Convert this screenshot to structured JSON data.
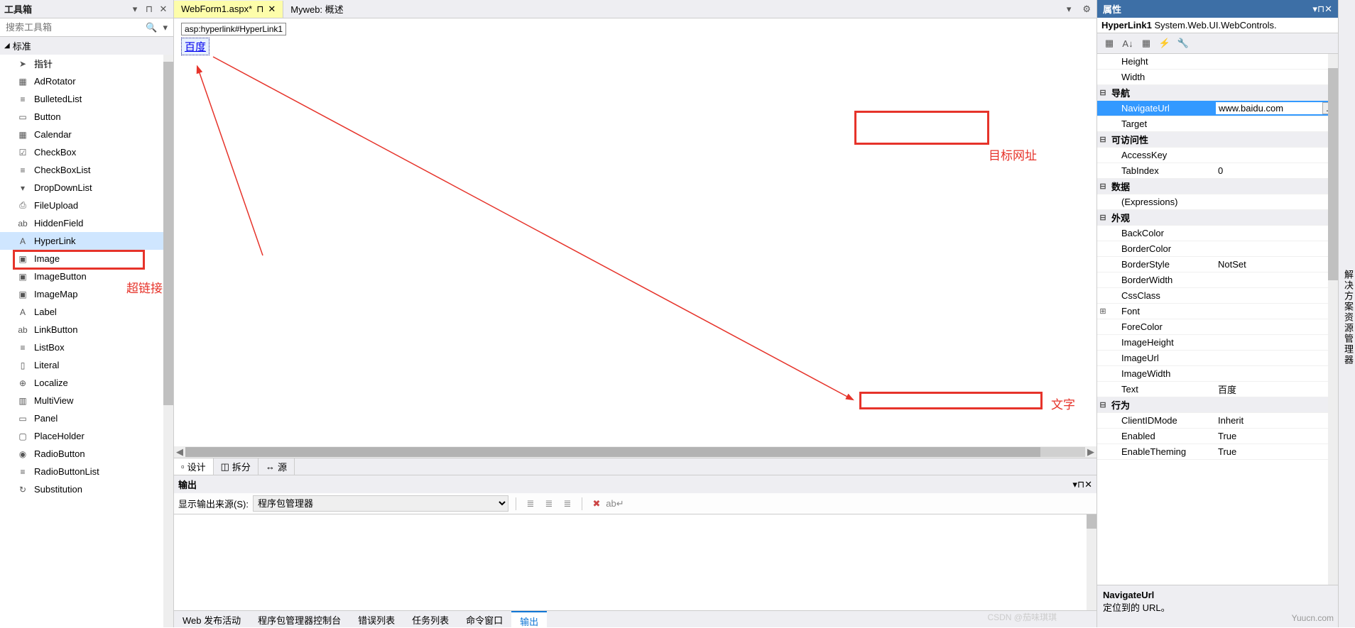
{
  "toolbox": {
    "title": "工具箱",
    "search_placeholder": "搜索工具箱",
    "category": "标准",
    "items": [
      {
        "icon": "➤",
        "label": "指针"
      },
      {
        "icon": "▦",
        "label": "AdRotator"
      },
      {
        "icon": "≡",
        "label": "BulletedList"
      },
      {
        "icon": "▭",
        "label": "Button"
      },
      {
        "icon": "▦",
        "label": "Calendar"
      },
      {
        "icon": "☑",
        "label": "CheckBox"
      },
      {
        "icon": "≡",
        "label": "CheckBoxList"
      },
      {
        "icon": "▾",
        "label": "DropDownList"
      },
      {
        "icon": "⎙",
        "label": "FileUpload"
      },
      {
        "icon": "ab",
        "label": "HiddenField"
      },
      {
        "icon": "A",
        "label": "HyperLink"
      },
      {
        "icon": "▣",
        "label": "Image"
      },
      {
        "icon": "▣",
        "label": "ImageButton"
      },
      {
        "icon": "▣",
        "label": "ImageMap"
      },
      {
        "icon": "A",
        "label": "Label"
      },
      {
        "icon": "ab",
        "label": "LinkButton"
      },
      {
        "icon": "≡",
        "label": "ListBox"
      },
      {
        "icon": "▯",
        "label": "Literal"
      },
      {
        "icon": "⊕",
        "label": "Localize"
      },
      {
        "icon": "▥",
        "label": "MultiView"
      },
      {
        "icon": "▭",
        "label": "Panel"
      },
      {
        "icon": "▢",
        "label": "PlaceHolder"
      },
      {
        "icon": "◉",
        "label": "RadioButton"
      },
      {
        "icon": "≡",
        "label": "RadioButtonList"
      },
      {
        "icon": "↻",
        "label": "Substitution"
      }
    ]
  },
  "editor": {
    "tab_active": "WebForm1.aspx*",
    "tab_secondary": "Myweb: 概述",
    "element_tag": "asp:hyperlink#HyperLink1",
    "hyperlink_text": "百度",
    "view_design": "设计",
    "view_split": "拆分",
    "view_source": "源"
  },
  "output": {
    "title": "输出",
    "source_label": "显示输出来源(S):",
    "source_value": "程序包管理器"
  },
  "bottom_tabs": [
    "Web 发布活动",
    "程序包管理器控制台",
    "错误列表",
    "任务列表",
    "命令窗口",
    "输出"
  ],
  "properties": {
    "title": "属性",
    "selector_name": "HyperLink1",
    "selector_type": "System.Web.UI.WebControls.",
    "rows": [
      {
        "type": "prop",
        "indent": true,
        "name": "Height",
        "value": ""
      },
      {
        "type": "prop",
        "indent": true,
        "name": "Width",
        "value": ""
      },
      {
        "type": "cat",
        "name": "导航"
      },
      {
        "type": "prop",
        "indent": true,
        "name": "NavigateUrl",
        "value": "www.baidu.com",
        "selected": true
      },
      {
        "type": "prop",
        "indent": true,
        "name": "Target",
        "value": ""
      },
      {
        "type": "cat",
        "name": "可访问性"
      },
      {
        "type": "prop",
        "indent": true,
        "name": "AccessKey",
        "value": ""
      },
      {
        "type": "prop",
        "indent": true,
        "name": "TabIndex",
        "value": "0"
      },
      {
        "type": "cat",
        "name": "数据"
      },
      {
        "type": "prop",
        "indent": true,
        "name": "(Expressions)",
        "value": ""
      },
      {
        "type": "cat",
        "name": "外观"
      },
      {
        "type": "prop",
        "indent": true,
        "name": "BackColor",
        "value": ""
      },
      {
        "type": "prop",
        "indent": true,
        "name": "BorderColor",
        "value": ""
      },
      {
        "type": "prop",
        "indent": true,
        "name": "BorderStyle",
        "value": "NotSet"
      },
      {
        "type": "prop",
        "indent": true,
        "name": "BorderWidth",
        "value": ""
      },
      {
        "type": "prop",
        "indent": true,
        "name": "CssClass",
        "value": ""
      },
      {
        "type": "prop",
        "indent": true,
        "name": "Font",
        "value": "",
        "plus": true
      },
      {
        "type": "prop",
        "indent": true,
        "name": "ForeColor",
        "value": ""
      },
      {
        "type": "prop",
        "indent": true,
        "name": "ImageHeight",
        "value": ""
      },
      {
        "type": "prop",
        "indent": true,
        "name": "ImageUrl",
        "value": ""
      },
      {
        "type": "prop",
        "indent": true,
        "name": "ImageWidth",
        "value": ""
      },
      {
        "type": "prop",
        "indent": true,
        "name": "Text",
        "value": "百度"
      },
      {
        "type": "cat",
        "name": "行为"
      },
      {
        "type": "prop",
        "indent": true,
        "name": "ClientIDMode",
        "value": "Inherit"
      },
      {
        "type": "prop",
        "indent": true,
        "name": "Enabled",
        "value": "True"
      },
      {
        "type": "prop",
        "indent": true,
        "name": "EnableTheming",
        "value": "True"
      }
    ],
    "desc_name": "NavigateUrl",
    "desc_text": "定位到的 URL。"
  },
  "solution_panel": "解决方案资源管理器",
  "annotations": {
    "hyperlink_label": "超链接",
    "target_url_label": "目标网址",
    "text_label": "文字"
  },
  "watermark_left": "CSDN @茄味琪琪",
  "watermark_right": "Yuucn.com"
}
